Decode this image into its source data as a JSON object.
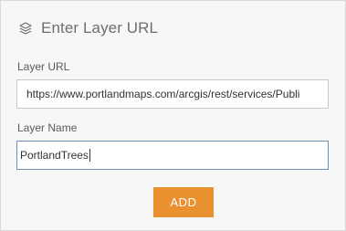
{
  "dialog": {
    "title": "Enter Layer URL",
    "title_icon": "layers-icon"
  },
  "fields": {
    "layer_url": {
      "label": "Layer URL",
      "value": "https://www.portlandmaps.com/arcgis/rest/services/Publi"
    },
    "layer_name": {
      "label": "Layer Name",
      "value": "PortlandTrees"
    }
  },
  "actions": {
    "add_label": "ADD"
  },
  "colors": {
    "accent": "#e8912e",
    "panel_bg": "#f7f7f7",
    "focus_border": "#6e8fb5"
  }
}
